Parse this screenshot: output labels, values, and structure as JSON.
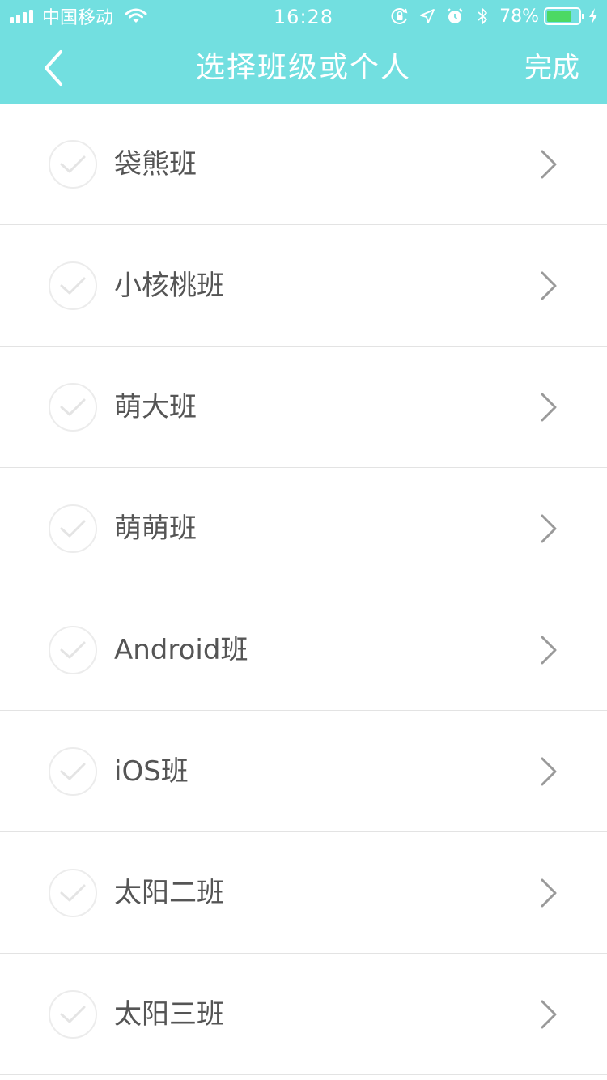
{
  "status_bar": {
    "carrier": "中国移动",
    "time": "16:28",
    "battery_percent": "78%",
    "battery_level": 0.78,
    "icons": [
      "signal-icon",
      "wifi-icon",
      "orientation-lock-icon",
      "location-icon",
      "alarm-icon",
      "bluetooth-icon",
      "battery-icon",
      "charging-bolt-icon"
    ]
  },
  "nav": {
    "back_icon": "chevron-left-icon",
    "title": "选择班级或个人",
    "done_label": "完成"
  },
  "list": {
    "items": [
      {
        "label": "袋熊班",
        "checked": false
      },
      {
        "label": "小核桃班",
        "checked": false
      },
      {
        "label": "萌大班",
        "checked": false
      },
      {
        "label": "萌萌班",
        "checked": false
      },
      {
        "label": "Android班",
        "checked": false
      },
      {
        "label": "iOS班",
        "checked": false
      },
      {
        "label": "太阳二班",
        "checked": false
      },
      {
        "label": "太阳三班",
        "checked": false
      }
    ]
  },
  "colors": {
    "header_bg": "#72dfe0",
    "text": "#555555",
    "check_ring": "#ececec",
    "chevron": "#9a9a9a",
    "battery_fill": "#4cd964"
  }
}
